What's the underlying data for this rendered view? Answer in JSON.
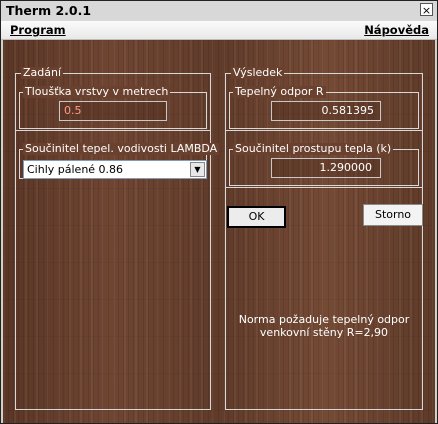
{
  "window": {
    "title": "Therm 2.0.1",
    "close_glyph": "×"
  },
  "menu": {
    "program": "Program",
    "help": "Nápověda"
  },
  "input_group": {
    "title": "Zadání",
    "thickness": {
      "label": "Tloušťka vrstvy v metrech",
      "value": "0.5"
    },
    "lambda": {
      "label": "Součinitel tepel. vodivosti LAMBDA",
      "selected": "Cihly pálené 0.86"
    }
  },
  "result_group": {
    "title": "Výsledek",
    "resistance": {
      "label": "Tepelný odpor R",
      "value": "0.581395"
    },
    "transfer": {
      "label": "Součinitel prostupu tepla (k)",
      "value": "1.290000"
    }
  },
  "buttons": {
    "ok": "OK",
    "cancel": "Storno"
  },
  "note": {
    "line1": "Norma požaduje tepelný odpor",
    "line2": "venkovní stěny R=2,90"
  },
  "colors": {
    "wood": "#6a412e",
    "input_value": "#ff9b8a",
    "text": "#ffffff"
  },
  "icons": {
    "close": "close-icon",
    "dropdown": "chevron-down-icon"
  }
}
